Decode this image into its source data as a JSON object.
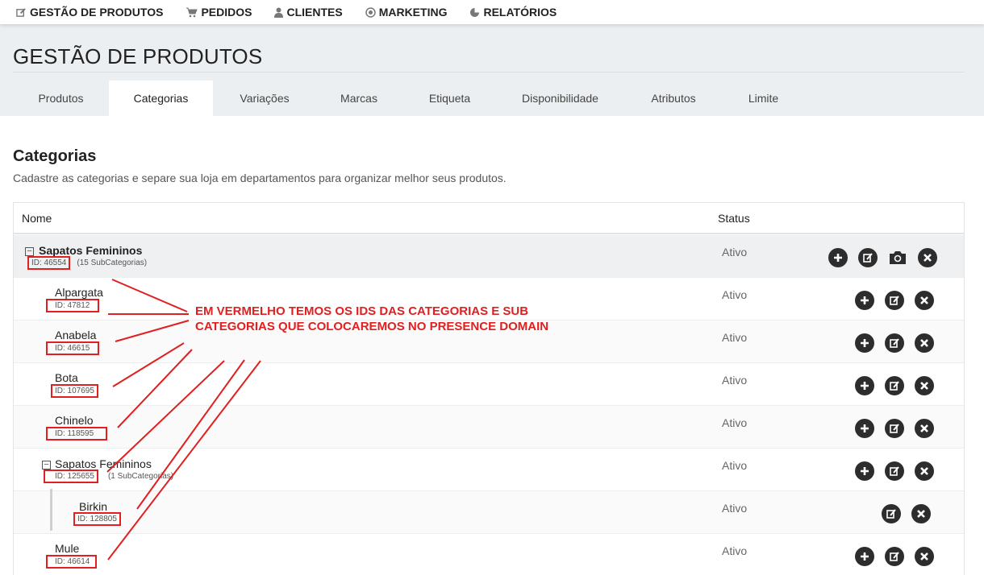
{
  "topnav": {
    "items": [
      {
        "label": "GESTÃO DE PRODUTOS",
        "icon": "edit-icon"
      },
      {
        "label": "PEDIDOS",
        "icon": "cart-icon"
      },
      {
        "label": "CLIENTES",
        "icon": "user-icon"
      },
      {
        "label": "MARKETING",
        "icon": "target-icon"
      },
      {
        "label": "RELATÓRIOS",
        "icon": "pie-chart-icon"
      }
    ]
  },
  "page": {
    "title": "GESTÃO DE PRODUTOS"
  },
  "tabs": [
    {
      "label": "Produtos",
      "active": false
    },
    {
      "label": "Categorias",
      "active": true
    },
    {
      "label": "Variações",
      "active": false
    },
    {
      "label": "Marcas",
      "active": false
    },
    {
      "label": "Etiqueta",
      "active": false
    },
    {
      "label": "Disponibilidade",
      "active": false
    },
    {
      "label": "Atributos",
      "active": false
    },
    {
      "label": "Limite",
      "active": false
    }
  ],
  "section": {
    "title": "Categorias",
    "description": "Cadastre as categorias e separe sua loja em departamentos para organizar melhor seus produtos."
  },
  "table": {
    "headers": {
      "name": "Nome",
      "status": "Status"
    },
    "rows": [
      {
        "name": "Sapatos Femininos",
        "id": "ID: 46554",
        "sub": "(15 SubCategorias)",
        "status": "Ativo",
        "actions": [
          "add-icon",
          "edit-icon",
          "camera-icon",
          "delete-icon"
        ]
      },
      {
        "name": "Alpargata",
        "id": "ID: 47812",
        "sub": "",
        "status": "Ativo",
        "actions": [
          "add-icon",
          "edit-icon",
          "delete-icon"
        ]
      },
      {
        "name": "Anabela",
        "id": "ID: 46615",
        "sub": "",
        "status": "Ativo",
        "actions": [
          "add-icon",
          "edit-icon",
          "delete-icon"
        ]
      },
      {
        "name": "Bota",
        "id": "ID: 107695",
        "sub": "",
        "status": "Ativo",
        "actions": [
          "add-icon",
          "edit-icon",
          "delete-icon"
        ]
      },
      {
        "name": "Chinelo",
        "id": "ID: 118595",
        "sub": "",
        "status": "Ativo",
        "actions": [
          "add-icon",
          "edit-icon",
          "delete-icon"
        ]
      },
      {
        "name": "Sapatos Femininos",
        "id": "ID: 125655",
        "sub": "(1 SubCategorias)",
        "status": "Ativo",
        "actions": [
          "add-icon",
          "edit-icon",
          "delete-icon"
        ]
      },
      {
        "name": "Birkin",
        "id": "ID: 128805",
        "sub": "",
        "status": "Ativo",
        "actions": [
          "edit-icon",
          "delete-icon"
        ]
      },
      {
        "name": "Mule",
        "id": "ID: 46614",
        "sub": "",
        "status": "Ativo",
        "actions": [
          "add-icon",
          "edit-icon",
          "delete-icon"
        ]
      }
    ]
  },
  "annotation": {
    "text": "EM VERMELHO TEMOS OS IDS DAS CATEGORIAS E SUB CATEGORIAS QUE COLOCAREMOS NO PRESENCE DOMAIN",
    "color": "#e02020"
  },
  "colors": {
    "accent_red": "#e02020",
    "header_bg": "#eceff1",
    "icon_dark": "#2d2d2d"
  }
}
